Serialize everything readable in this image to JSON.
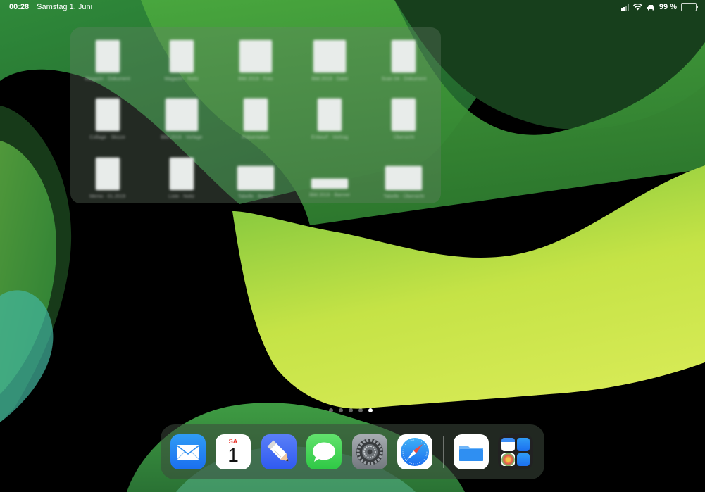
{
  "status_bar": {
    "time": "00:28",
    "date": "Samstag 1. Juni",
    "battery": "99 %",
    "battery_level": 0.99
  },
  "files_widget": {
    "items": [
      {
        "label": "Magazin · Dokument",
        "thumb": "portrait"
      },
      {
        "label": "Magazin · Notiz",
        "thumb": "portrait"
      },
      {
        "label": "Bild 2019 · Foto",
        "thumb": "square"
      },
      {
        "label": "Bild 2019 · Datei",
        "thumb": "square"
      },
      {
        "label": "Scan 04 · Dokument",
        "thumb": "portrait"
      },
      {
        "label": "Collage · Skizze",
        "thumb": "portrait"
      },
      {
        "label": "Bild 2019 · Vorlage",
        "thumb": "square"
      },
      {
        "label": "Präsentation",
        "thumb": "portrait"
      },
      {
        "label": "Entwurf · Vortrag",
        "thumb": "portrait"
      },
      {
        "label": "Übersicht",
        "thumb": "portrait"
      },
      {
        "label": "Memo · 01.2019",
        "thumb": "portrait"
      },
      {
        "label": "Liste · Notiz",
        "thumb": "portrait"
      },
      {
        "label": "Tabelle · Bericht",
        "thumb": "landscape"
      },
      {
        "label": "Bild 2019 · Banner",
        "thumb": "strip"
      },
      {
        "label": "Tabelle · Übersicht",
        "thumb": "landscape"
      }
    ]
  },
  "page_dots": {
    "count": 5,
    "active_index": 4
  },
  "dock": {
    "apps": [
      {
        "name": "Mail"
      },
      {
        "name": "Kalender",
        "day": "SA",
        "date_num": "1"
      },
      {
        "name": "Pencil"
      },
      {
        "name": "Nachrichten"
      },
      {
        "name": "Einstellungen"
      },
      {
        "name": "Safari"
      },
      {
        "name": "Dateien"
      },
      {
        "name": "Zuletzt verwendet"
      }
    ]
  },
  "colors": {
    "wallpaper_deep": "#1f5e2a",
    "wallpaper_mid": "#3f9a3a",
    "wallpaper_light": "#c6e34a",
    "accent_blue": "#1b6ff0",
    "calendar_red": "#e8332a"
  }
}
